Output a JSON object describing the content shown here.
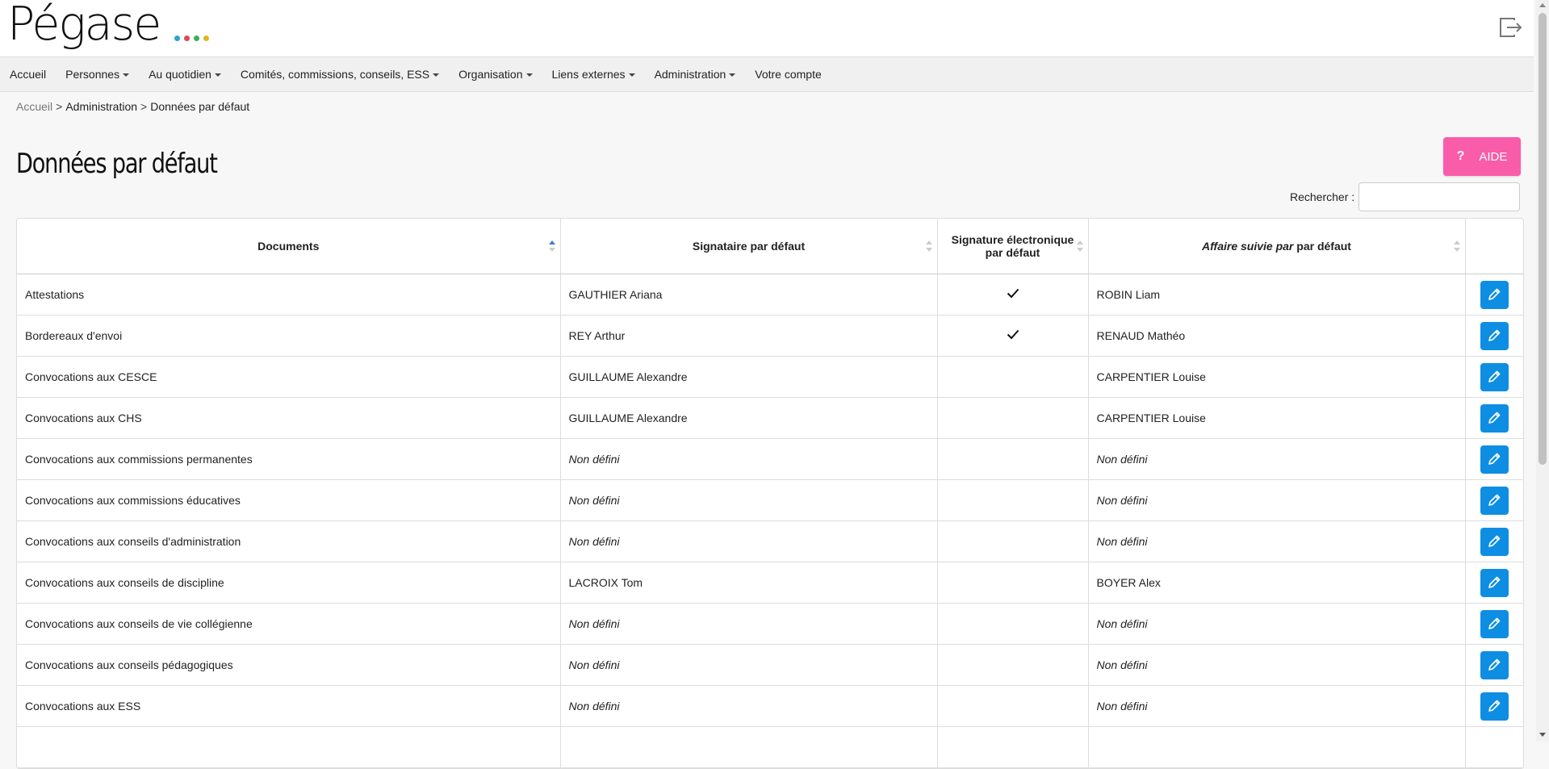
{
  "brand": {
    "name": "Pégase",
    "dot_colors": [
      "#2aa5c9",
      "#e0465a",
      "#3dae55",
      "#e3b51c"
    ]
  },
  "nav": {
    "items": [
      {
        "label": "Accueil",
        "dropdown": false
      },
      {
        "label": "Personnes",
        "dropdown": true
      },
      {
        "label": "Au quotidien",
        "dropdown": true
      },
      {
        "label": "Comités, commissions, conseils, ESS",
        "dropdown": true
      },
      {
        "label": "Organisation",
        "dropdown": true
      },
      {
        "label": "Liens externes",
        "dropdown": true
      },
      {
        "label": "Administration",
        "dropdown": true
      },
      {
        "label": "Votre compte",
        "dropdown": false
      }
    ]
  },
  "breadcrumb": {
    "home": "Accueil",
    "sep": ">",
    "section": "Administration",
    "current": "Données par défaut"
  },
  "page": {
    "title": "Données par défaut"
  },
  "help_button": {
    "icon": "?",
    "label": "AIDE",
    "color": "#f95ca9"
  },
  "search": {
    "label": "Rechercher :",
    "value": ""
  },
  "table": {
    "columns": {
      "documents": "Documents",
      "signataire": "Signataire par défaut",
      "signature_elec": "Signature électronique par défaut",
      "affaire_italic": "Affaire suivie par",
      "affaire_rest": " par défaut"
    },
    "rows": [
      {
        "document": "Attestations",
        "signataire": "GAUTHIER Ariana",
        "esign": true,
        "affaire": "ROBIN Liam"
      },
      {
        "document": "Bordereaux d'envoi",
        "signataire": "REY Arthur",
        "esign": true,
        "affaire": "RENAUD Mathéo"
      },
      {
        "document": "Convocations aux CESCE",
        "signataire": "GUILLAUME Alexandre",
        "esign": false,
        "affaire": "CARPENTIER Louise"
      },
      {
        "document": "Convocations aux CHS",
        "signataire": "GUILLAUME Alexandre",
        "esign": false,
        "affaire": "CARPENTIER Louise"
      },
      {
        "document": "Convocations aux commissions permanentes",
        "signataire": "Non défini",
        "esign": false,
        "affaire": "Non défini"
      },
      {
        "document": "Convocations aux commissions éducatives",
        "signataire": "Non défini",
        "esign": false,
        "affaire": "Non défini"
      },
      {
        "document": "Convocations aux conseils d'administration",
        "signataire": "Non défini",
        "esign": false,
        "affaire": "Non défini"
      },
      {
        "document": "Convocations aux conseils de discipline",
        "signataire": "LACROIX Tom",
        "esign": false,
        "affaire": "BOYER Alex"
      },
      {
        "document": "Convocations aux conseils de vie collégienne",
        "signataire": "Non défini",
        "esign": false,
        "affaire": "Non défini"
      },
      {
        "document": "Convocations aux conseils pédagogiques",
        "signataire": "Non défini",
        "esign": false,
        "affaire": "Non défini"
      },
      {
        "document": "Convocations aux ESS",
        "signataire": "Non défini",
        "esign": false,
        "affaire": "Non défini"
      },
      {
        "document": "",
        "signataire": "",
        "esign": false,
        "affaire": ""
      }
    ],
    "edit_icon": "pencil-icon",
    "check_icon": "checkmark-icon",
    "undefined_text": "Non défini"
  },
  "colors": {
    "edit_button": "#0e8ee3",
    "nav_bg": "#f0f0f0"
  }
}
